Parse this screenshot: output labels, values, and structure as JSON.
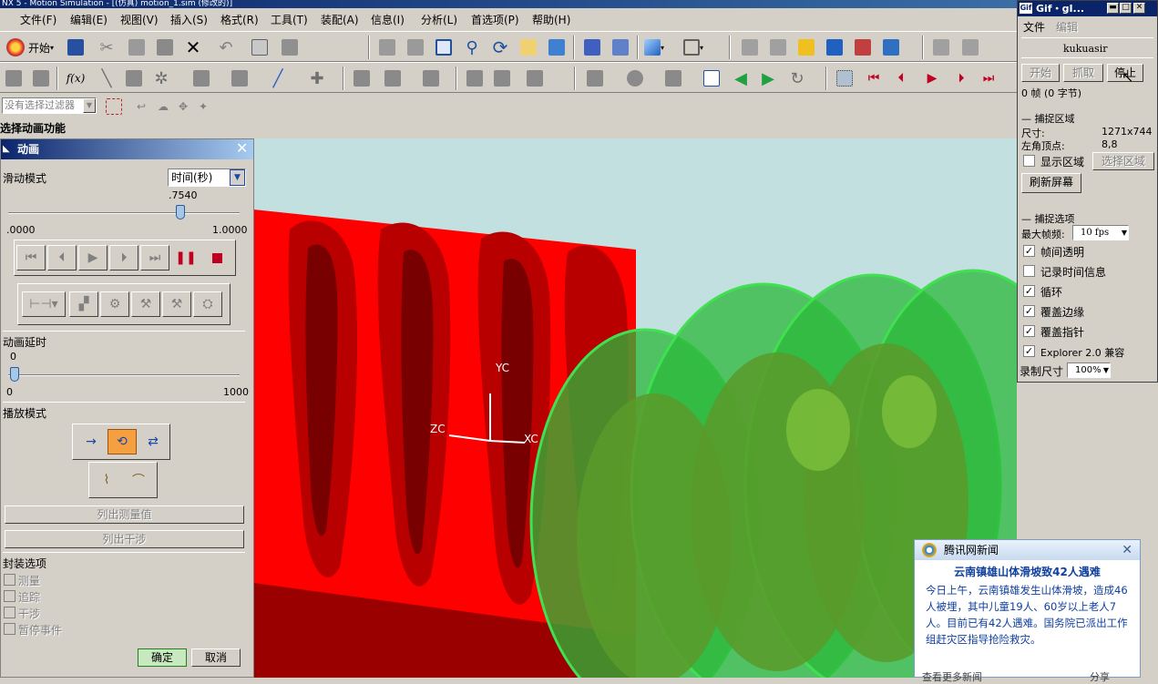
{
  "titlebar": {
    "text": "NX 5 - Motion Simulation - [(仿真) motion_1.sim (修改的)]"
  },
  "menu": [
    "文件(F)",
    "编辑(E)",
    "视图(V)",
    "插入(S)",
    "格式(R)",
    "工具(T)",
    "装配(A)",
    "信息(I)",
    "分析(L)",
    "首选项(P)",
    "帮助(H)"
  ],
  "toolbar": {
    "start_label": "开始",
    "filter_placeholder": "没有选择过滤器"
  },
  "cue_line": "选择动画功能",
  "animation_dialog": {
    "title": "动画",
    "slide_mode_label": "滑动模式",
    "slide_mode_value": "时间(秒)",
    "time_value": ".7540",
    "time_fraction": 0.754,
    "time_min": ".0000",
    "time_max": "1.0000",
    "delay_label": "动画延时",
    "delay_value": "0",
    "delay_min": "0",
    "delay_max": "1000",
    "playback_label": "播放模式",
    "list_measure": "列出测量值",
    "list_interference": "列出干涉",
    "packaging_label": "封装选项",
    "packaging_options": [
      "测量",
      "追踪",
      "干涉",
      "暂停事件"
    ],
    "ok": "确定",
    "cancel": "取消"
  },
  "viewport": {
    "axis_y": "YC",
    "axis_x": "XC",
    "axis_z": "ZC",
    "colors": {
      "background": "#c2e0e0",
      "red_part": "#ff0000",
      "green_part": "#30c040"
    }
  },
  "gif_recorder": {
    "title": "Gif・gI...",
    "menu_file": "文件",
    "menu_edit": "编辑",
    "user": "kukuasir",
    "btn_start": "开始",
    "btn_capture": "抓取",
    "btn_stop": "停止",
    "frames": "0 帧 (0 字节)",
    "capture_area_label": "捕捉区域",
    "size_label": "尺寸:",
    "size_value": "1271x744",
    "corner_label": "左角顶点:",
    "corner_value": "8,8",
    "show_area": "显示区域",
    "select_area": "选择区域",
    "refresh": "刷新屏幕",
    "capture_options_label": "捕捉选项",
    "max_fps_label": "最大帧频:",
    "max_fps_value": "10 fps",
    "options": [
      {
        "label": "帧间透明",
        "checked": true
      },
      {
        "label": "记录时间信息",
        "checked": false
      },
      {
        "label": "循环",
        "checked": true
      },
      {
        "label": "覆盖边缘",
        "checked": true
      },
      {
        "label": "覆盖指针",
        "checked": true
      },
      {
        "label": "Explorer 2.0 兼容",
        "checked": true
      }
    ],
    "record_size_label": "录制尺寸",
    "record_size_value": "100%"
  },
  "news": {
    "source": "腾讯网新闻",
    "headline": "云南镇雄山体滑坡致42人遇难",
    "body": "今日上午，云南镇雄发生山体滑坡，造成46人被埋，其中儿童19人、60岁以上老人7人。目前已有42人遇难。国务院已派出工作组赶灾区指导抢险救灾。",
    "footer_more": "查看更多新闻",
    "footer_share": "分享"
  }
}
